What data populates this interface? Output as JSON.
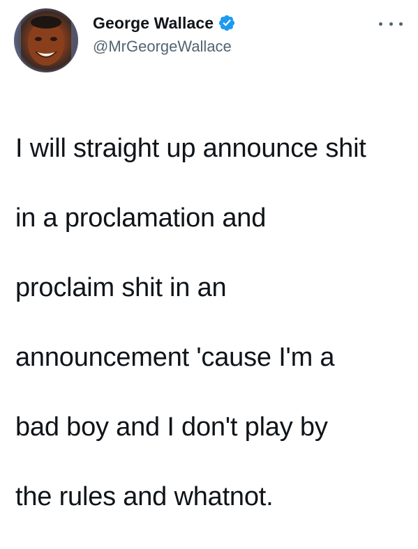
{
  "tweet": {
    "author": {
      "display_name": "George Wallace",
      "handle": "@MrGeorgeWallace",
      "verified": true,
      "avatar_icon": "profile-photo",
      "verified_icon": "verified-badge-icon",
      "verified_color": "#1d9bf0"
    },
    "more_icon": "more-horizontal-icon",
    "text_lines": [
      "I will straight up announce shit",
      "in a proclamation and",
      "proclaim shit in an",
      "announcement 'cause I'm a",
      "bad boy and I don't play by",
      "the rules and whatnot."
    ]
  },
  "colors": {
    "text_primary": "#0f1419",
    "text_secondary": "#536471",
    "background": "#ffffff"
  }
}
